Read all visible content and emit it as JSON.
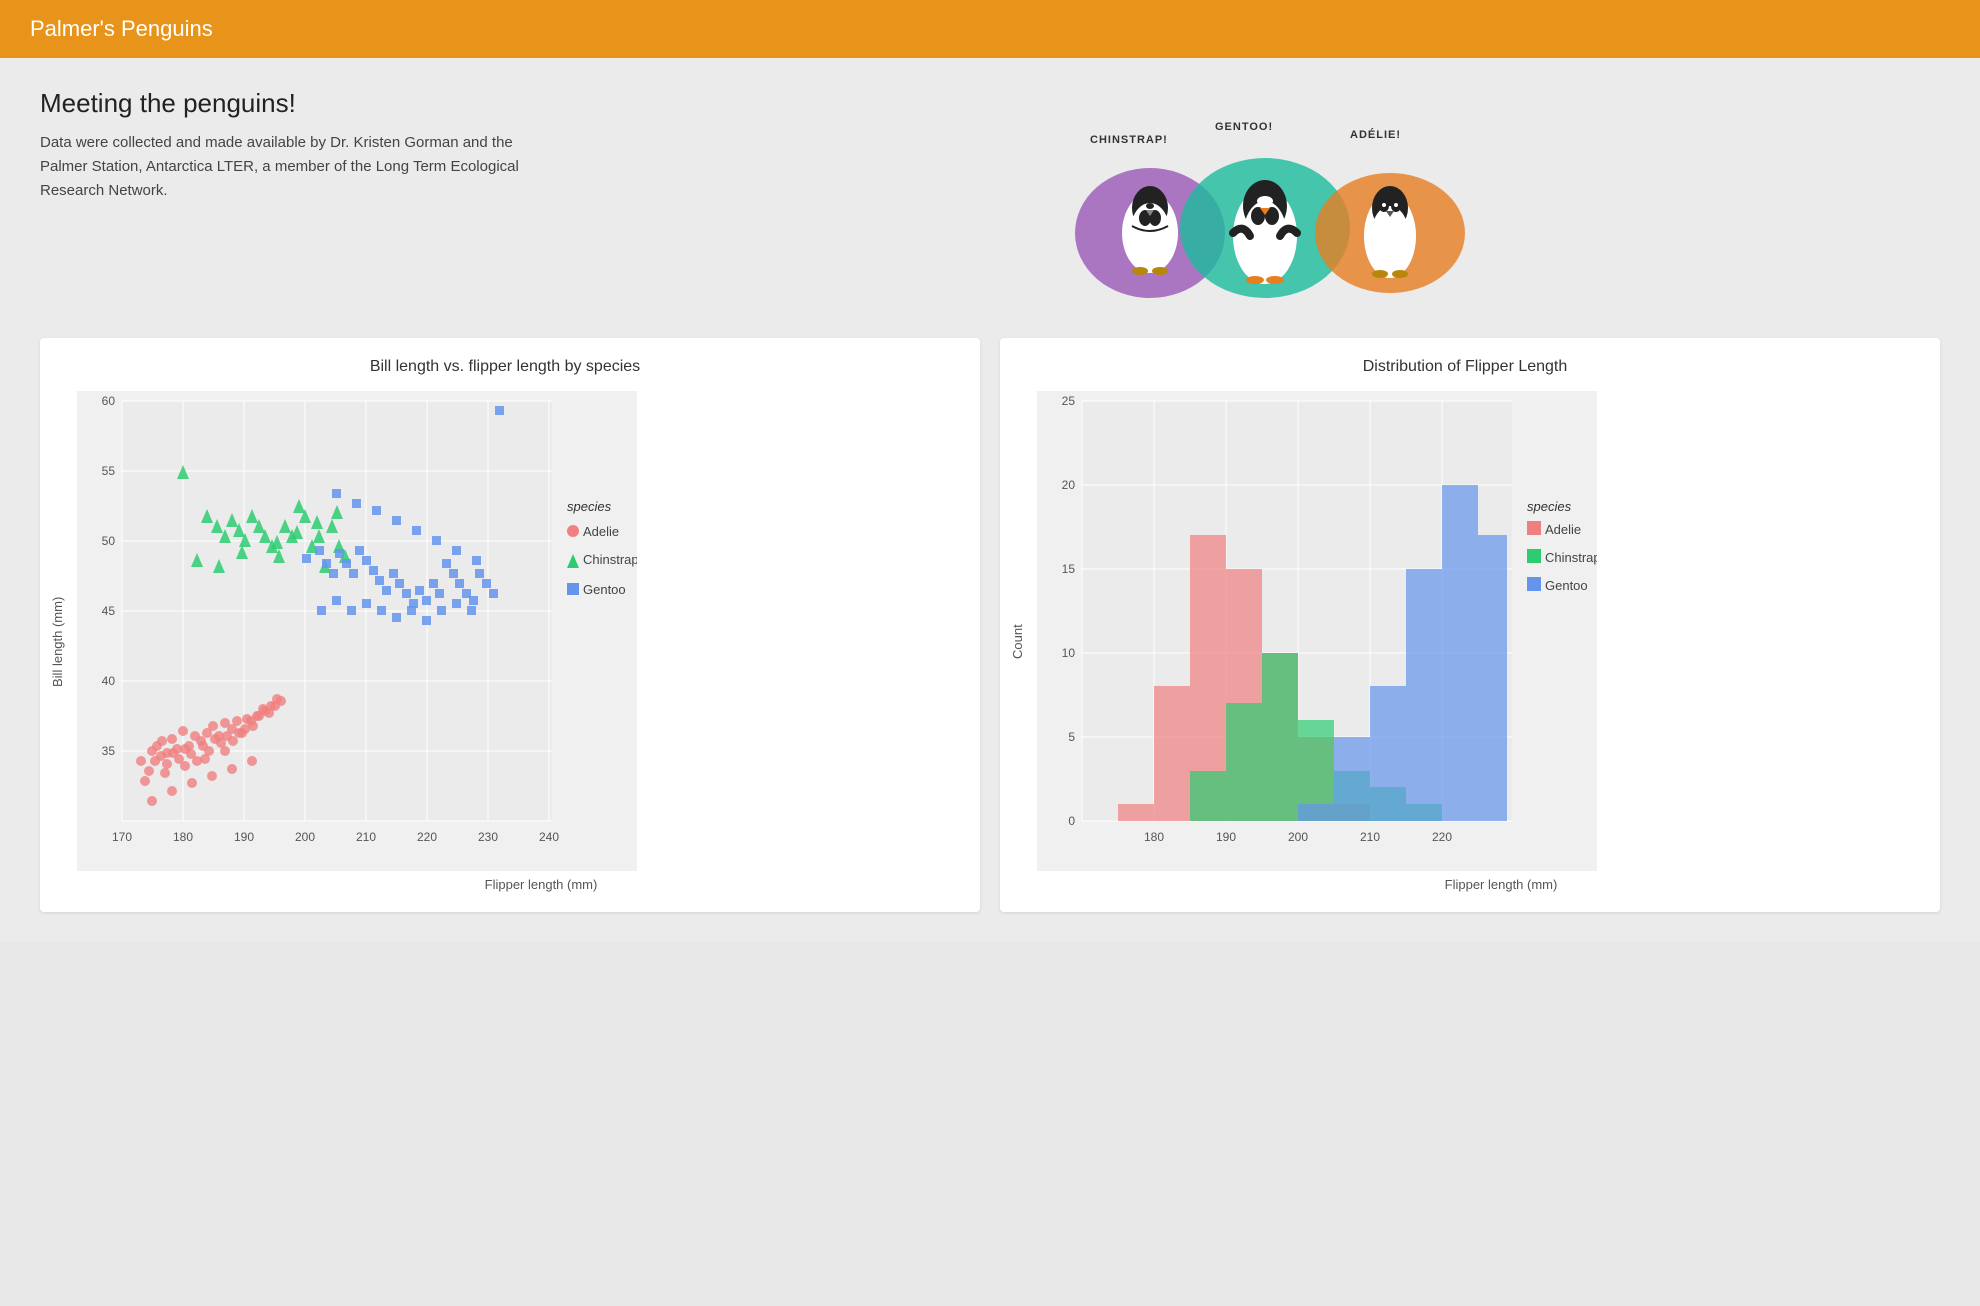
{
  "header": {
    "title": "Palmer's Penguins"
  },
  "intro": {
    "heading": "Meeting the penguins!",
    "description": "Data were collected and made available by Dr. Kristen Gorman and the Palmer Station, Antarctica LTER, a member of the Long Term Ecological Research Network.",
    "penguin_labels": [
      "CHINSTRAP!",
      "GENTOO!",
      "ADÉLIE!"
    ]
  },
  "scatter_chart": {
    "title": "Bill length vs. flipper length by species",
    "x_label": "Flipper length (mm)",
    "y_label": "Bill length (mm)",
    "x_ticks": [
      "170",
      "180",
      "190",
      "200",
      "210",
      "220",
      "230"
    ],
    "y_ticks": [
      "60",
      "55",
      "50",
      "45",
      "40",
      "35"
    ],
    "legend_title": "species",
    "legend_items": [
      {
        "label": "Adelie",
        "shape": "circle",
        "color": "#F08080"
      },
      {
        "label": "Chinstrap",
        "shape": "triangle",
        "color": "#2ecc71"
      },
      {
        "label": "Gentoo",
        "shape": "square",
        "color": "#6495ED"
      }
    ]
  },
  "histogram_chart": {
    "title": "Distribution of Flipper Length",
    "x_label": "Flipper length (mm)",
    "y_label": "Count",
    "x_ticks": [
      "180",
      "190",
      "200",
      "210",
      "220"
    ],
    "y_ticks": [
      "25",
      "20",
      "15",
      "10",
      "5",
      "0"
    ],
    "legend_title": "species",
    "legend_items": [
      {
        "label": "Adelie",
        "color": "#F08080"
      },
      {
        "label": "Chinstrap",
        "color": "#2ecc71"
      },
      {
        "label": "Gentoo",
        "color": "#6495ED"
      }
    ]
  }
}
